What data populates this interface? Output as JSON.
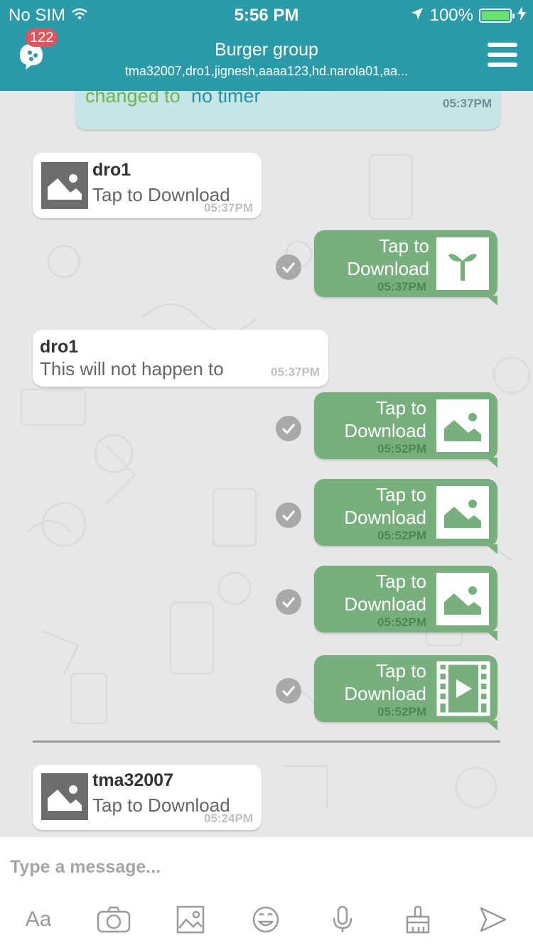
{
  "status": {
    "carrier": "No SIM",
    "time": "5:56 PM",
    "battery": "100%"
  },
  "header": {
    "badge_count": "122",
    "title": "Burger group",
    "subtitle": "tma32007,dro1,jignesh,aaaa123,hd.narola01,aa...",
    "icons": [
      "chat-app-icon",
      "hamburger-menu-icon"
    ]
  },
  "messages": [
    {
      "type": "system",
      "prefix": "changed to",
      "value": "no timer",
      "time": "05:37PM"
    },
    {
      "type": "incoming-image",
      "sender": "dro1",
      "text": "Tap to Download",
      "time": "05:37PM",
      "icon": "image-placeholder-icon"
    },
    {
      "type": "outgoing-file",
      "text_line1": "Tap to",
      "text_line2": "Download",
      "time": "05:37PM",
      "icon": "sprout-icon"
    },
    {
      "type": "incoming-text",
      "sender": "dro1",
      "text": "This will not happen to",
      "time": "05:37PM"
    },
    {
      "type": "outgoing-file",
      "text_line1": "Tap to",
      "text_line2": "Download",
      "time": "05:52PM",
      "icon": "image-icon"
    },
    {
      "type": "outgoing-file",
      "text_line1": "Tap to",
      "text_line2": "Download",
      "time": "05:52PM",
      "icon": "image-icon"
    },
    {
      "type": "outgoing-file",
      "text_line1": "Tap to",
      "text_line2": "Download",
      "time": "05:52PM",
      "icon": "image-icon"
    },
    {
      "type": "outgoing-file",
      "text_line1": "Tap to",
      "text_line2": "Download",
      "time": "05:52PM",
      "icon": "video-icon"
    },
    {
      "type": "incoming-image",
      "sender": "tma32007",
      "text": "Tap to Download",
      "time": "05:24PM",
      "icon": "image-placeholder-icon"
    }
  ],
  "composer": {
    "placeholder": "Type a message...",
    "tools": [
      {
        "name": "text-format",
        "label": "Aa"
      },
      {
        "name": "camera-icon"
      },
      {
        "name": "gallery-icon"
      },
      {
        "name": "emoji-icon"
      },
      {
        "name": "microphone-icon"
      },
      {
        "name": "paint-brush-icon"
      },
      {
        "name": "send-icon"
      }
    ]
  },
  "colors": {
    "header": "#2b9aa9",
    "outgoing_bubble": "#78b07d",
    "system_bubble": "#c7e5e6",
    "badge": "#e0545a",
    "system_prefix": "#6cb54e",
    "system_value": "#1f93a4"
  }
}
